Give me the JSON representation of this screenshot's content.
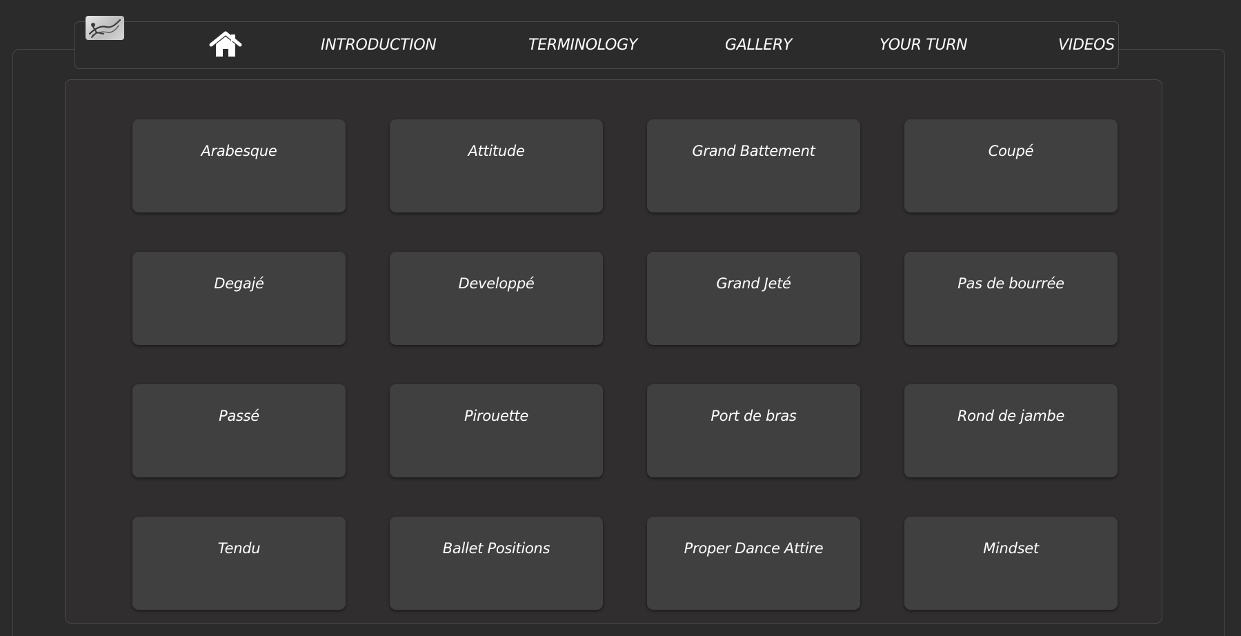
{
  "nav": {
    "logo": "dancer-logo",
    "home": "home-icon",
    "items": [
      {
        "label": "INTRODUCTION"
      },
      {
        "label": "TERMINOLOGY"
      },
      {
        "label": "GALLERY"
      },
      {
        "label": "YOUR TURN"
      },
      {
        "label": "VIDEOS"
      }
    ]
  },
  "terms": [
    {
      "label": "Arabesque"
    },
    {
      "label": "Attitude"
    },
    {
      "label": "Grand Battement"
    },
    {
      "label": "Coupé"
    },
    {
      "label": "Degajé"
    },
    {
      "label": "Developpé"
    },
    {
      "label": "Grand Jeté"
    },
    {
      "label": "Pas de bourrée"
    },
    {
      "label": "Passé"
    },
    {
      "label": "Pirouette"
    },
    {
      "label": "Port de bras"
    },
    {
      "label": "Rond de jambe"
    },
    {
      "label": "Tendu"
    },
    {
      "label": "Ballet Positions"
    },
    {
      "label": "Proper Dance Attire"
    },
    {
      "label": "Mindset"
    }
  ],
  "colors": {
    "background": "#2b2b2b",
    "panel": "#302e2f",
    "card": "#414041",
    "text": "#ffffff"
  }
}
